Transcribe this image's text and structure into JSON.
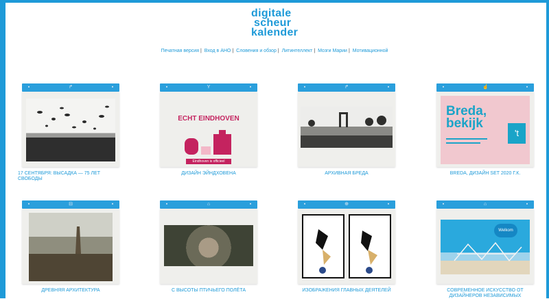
{
  "logo": {
    "line1": "digitale",
    "line2": "scheur",
    "line3": "kalender"
  },
  "nav": {
    "items": [
      "Печатная версия",
      "Вход в АНО",
      "Словения и обзор",
      "Литинтеллект",
      "Мозги Марии",
      "Мотивационной"
    ]
  },
  "cards": [
    {
      "id": 1,
      "caption": "17 СЕНТЯБРЯ: ВЫСАДКА — 75 ЛЕТ СВОБОДЫ",
      "top_icon": "↱"
    },
    {
      "id": 2,
      "caption": "ДИЗАЙН ЭЙНДХОВЕНА",
      "top_icon": "Y",
      "headline": "ECHT EINDHOVEN",
      "banner": "Eindhoven is officieel"
    },
    {
      "id": 3,
      "caption": "АРХИВНАЯ БРЕДА",
      "top_icon": "↱"
    },
    {
      "id": 4,
      "caption": "BREDA, ДИЗАЙН SET 2020 Г.К.",
      "top_icon": "☝",
      "headline1": "Breda,",
      "headline2": "bekijk",
      "headline3": "'t"
    },
    {
      "id": 5,
      "caption": "ДРЕВНЯЯ АРХИТЕКТУРА",
      "top_icon": "⊟"
    },
    {
      "id": 6,
      "caption": "С ВЫСОТЫ ПТИЧЬЕГО ПОЛЁТА",
      "top_icon": "⌂"
    },
    {
      "id": 7,
      "caption": "ИЗОБРАЖЕНИЯ ГЛАВНЫХ ДЕЯТЕЛЕЙ",
      "top_icon": "⊕"
    },
    {
      "id": 8,
      "caption": "СОВРЕМЕННОЕ ИСКУССТВО ОТ ДИЗАЙНЕРОВ НЕЗАВИСИМЫХ",
      "top_icon": "⌂",
      "badge": "Welkom"
    }
  ],
  "colors": {
    "accent": "#1e9ad8",
    "bar": "#2a9fdc",
    "card_bg": "#efefec",
    "pink": "#f1c8cf",
    "magenta": "#c4235f"
  }
}
